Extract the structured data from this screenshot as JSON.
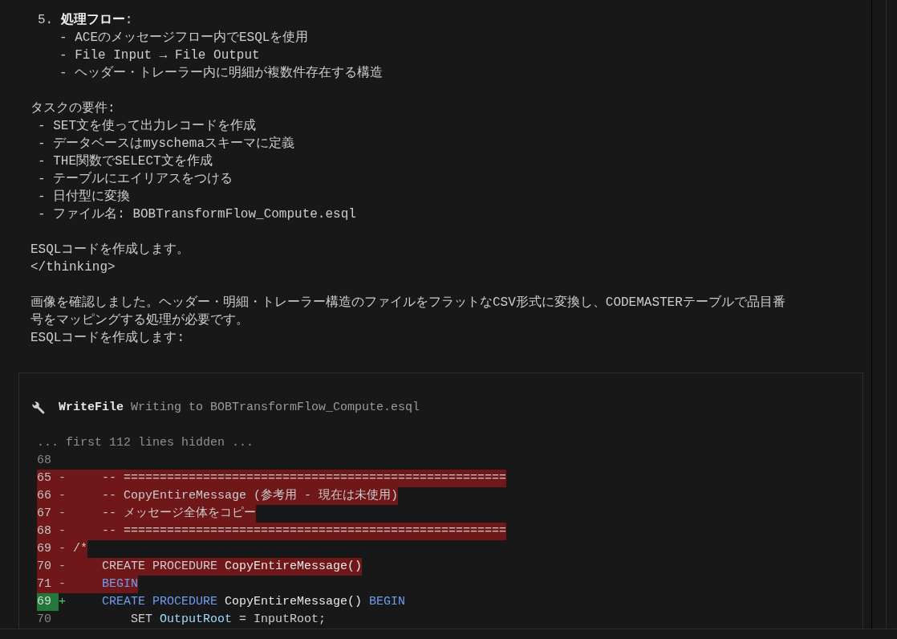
{
  "message": {
    "blocks": [
      {
        "kind": "numbered",
        "text": "5. **処理フロー**:",
        "children": [
          {
            "text": "- ACEのメッセージフロー内でESQLを使用"
          },
          {
            "text": "- File Input → File Output"
          },
          {
            "text": "- ヘッダー・トレーラー内に明細が複数件存在する構造"
          }
        ]
      },
      {
        "kind": "heading",
        "text": "タスクの要件:",
        "children": [
          {
            "text": "- SET文を使って出力レコードを作成"
          },
          {
            "text": "- データベースはmyschemaスキーマに定義"
          },
          {
            "text": "- THE関数でSELECT文を作成"
          },
          {
            "text": "- テーブルにエイリアスをつける"
          },
          {
            "text": "- 日付型に変換"
          },
          {
            "text": "- ファイル名: BOBTransformFlow_Compute.esql"
          }
        ]
      },
      {
        "kind": "paragraph",
        "lines": [
          "ESQLコードを作成します。",
          "</thinking>"
        ]
      },
      {
        "kind": "paragraph",
        "lines": [
          "画像を確認しました。ヘッダー・明細・トレーラー構造のファイルをフラットなCSV形式に変換し、CODEMASTERテーブルで品目番号をマッピングする処理が必要です。",
          "ESQLコードを作成します:"
        ]
      }
    ]
  },
  "tool_call": {
    "name": "WriteFile",
    "description": "Writing to BOBTransformFlow_Compute.esql",
    "note": "... first 112 lines hidden ...",
    "diff_lines": [
      {
        "kind": "context",
        "number": "68"
      },
      {
        "kind": "removed",
        "number": "65",
        "marker": "-",
        "tokens": [
          {
            "kind": "text",
            "text": "    -- ====================================================="
          }
        ]
      },
      {
        "kind": "removed",
        "number": "66",
        "marker": "-",
        "tokens": [
          {
            "kind": "text",
            "text": "    -- CopyEntireMessage (参考用 - 現在は未使用)"
          }
        ]
      },
      {
        "kind": "removed",
        "number": "67",
        "marker": "-",
        "tokens": [
          {
            "kind": "text",
            "text": "    -- メッセージ全体をコピー"
          }
        ]
      },
      {
        "kind": "removed",
        "number": "68",
        "marker": "-",
        "tokens": [
          {
            "kind": "text",
            "text": "    -- ====================================================="
          }
        ]
      },
      {
        "kind": "removed",
        "number": "69",
        "marker": "-",
        "tokens": [
          {
            "kind": "text",
            "text": "/*"
          }
        ]
      },
      {
        "kind": "removed",
        "number": "70",
        "marker": "-",
        "tokens": [
          {
            "kind": "text",
            "text": "    CREATE PROCEDURE"
          },
          {
            "kind": "name",
            "text": " CopyEntireMessage()"
          }
        ]
      },
      {
        "kind": "removed",
        "number": "71",
        "marker": "-",
        "tokens": [
          {
            "kind": "keyword",
            "text": "    BEGIN"
          }
        ]
      },
      {
        "kind": "added",
        "number": "69",
        "marker": "+",
        "tokens": [
          {
            "kind": "keyword",
            "text": "    CREATE PROCEDURE"
          },
          {
            "kind": "name",
            "text": " CopyEntireMessage()"
          },
          {
            "kind": "keyword",
            "text": " BEGIN"
          }
        ]
      },
      {
        "kind": "context",
        "number": "70",
        "tokens": [
          {
            "kind": "text",
            "text": "        SET"
          },
          {
            "kind": "variable",
            "text": " OutputRoot"
          },
          {
            "kind": "text",
            "text": " = InputRoot;"
          }
        ]
      }
    ]
  }
}
